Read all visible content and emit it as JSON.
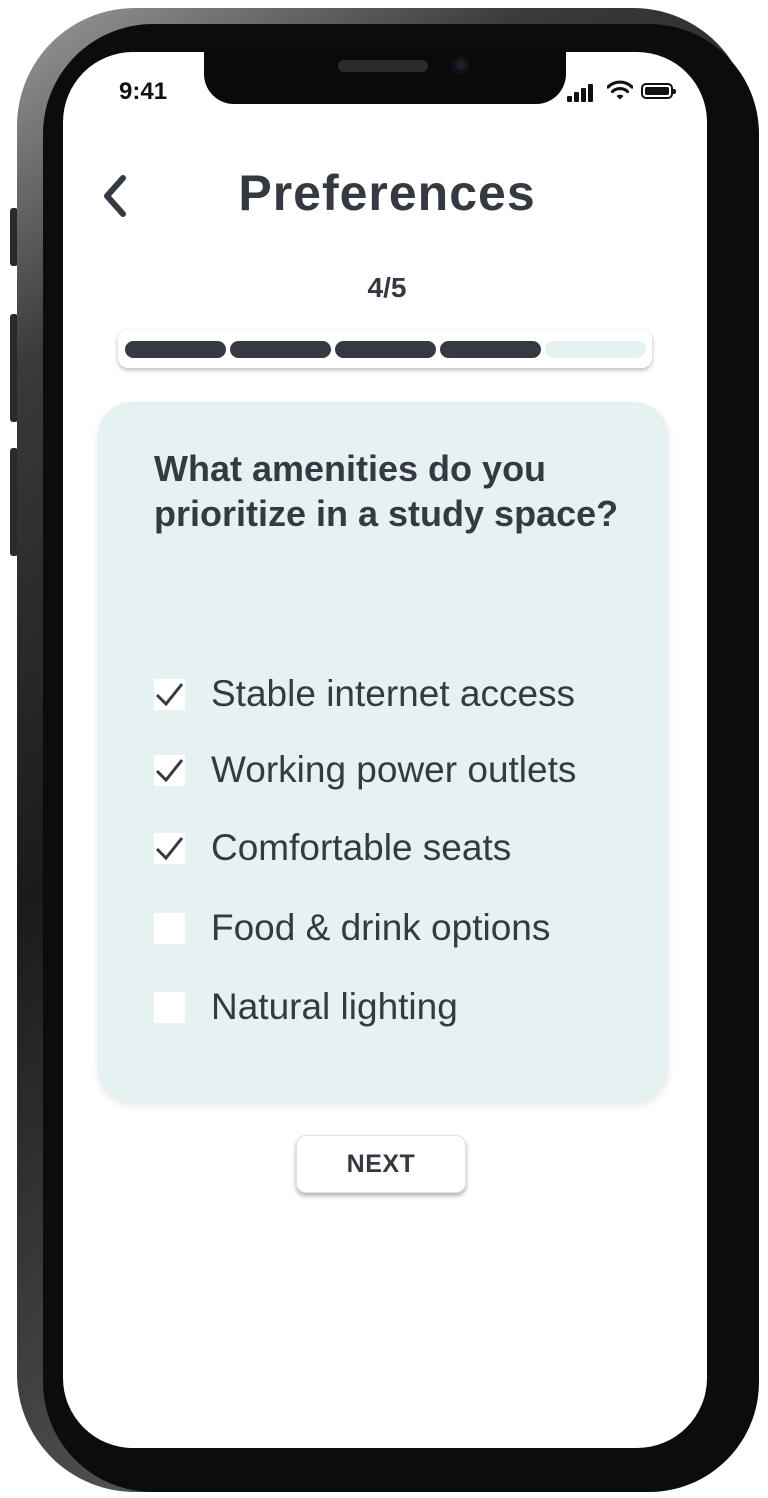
{
  "status_bar": {
    "time": "9:41"
  },
  "header": {
    "title": "Preferences"
  },
  "progress": {
    "label": "4/5",
    "current_step": 4,
    "total_steps": 5
  },
  "question": {
    "text": "What amenities do you prioritize in a study space?",
    "options": [
      {
        "label": "Stable internet access",
        "checked": true
      },
      {
        "label": "Working power outlets",
        "checked": true
      },
      {
        "label": "Comfortable seats",
        "checked": true
      },
      {
        "label": "Food & drink options",
        "checked": false
      },
      {
        "label": "Natural lighting",
        "checked": false
      }
    ]
  },
  "footer": {
    "next_label": "NEXT"
  },
  "colors": {
    "text": "#353a42",
    "progress_filled": "#353a42",
    "progress_empty": "#e6f2f2",
    "card_background": "#e6f2f2"
  },
  "icons": [
    "back-chevron-icon",
    "signal-icon",
    "wifi-icon",
    "battery-icon",
    "checkmark-icon"
  ]
}
